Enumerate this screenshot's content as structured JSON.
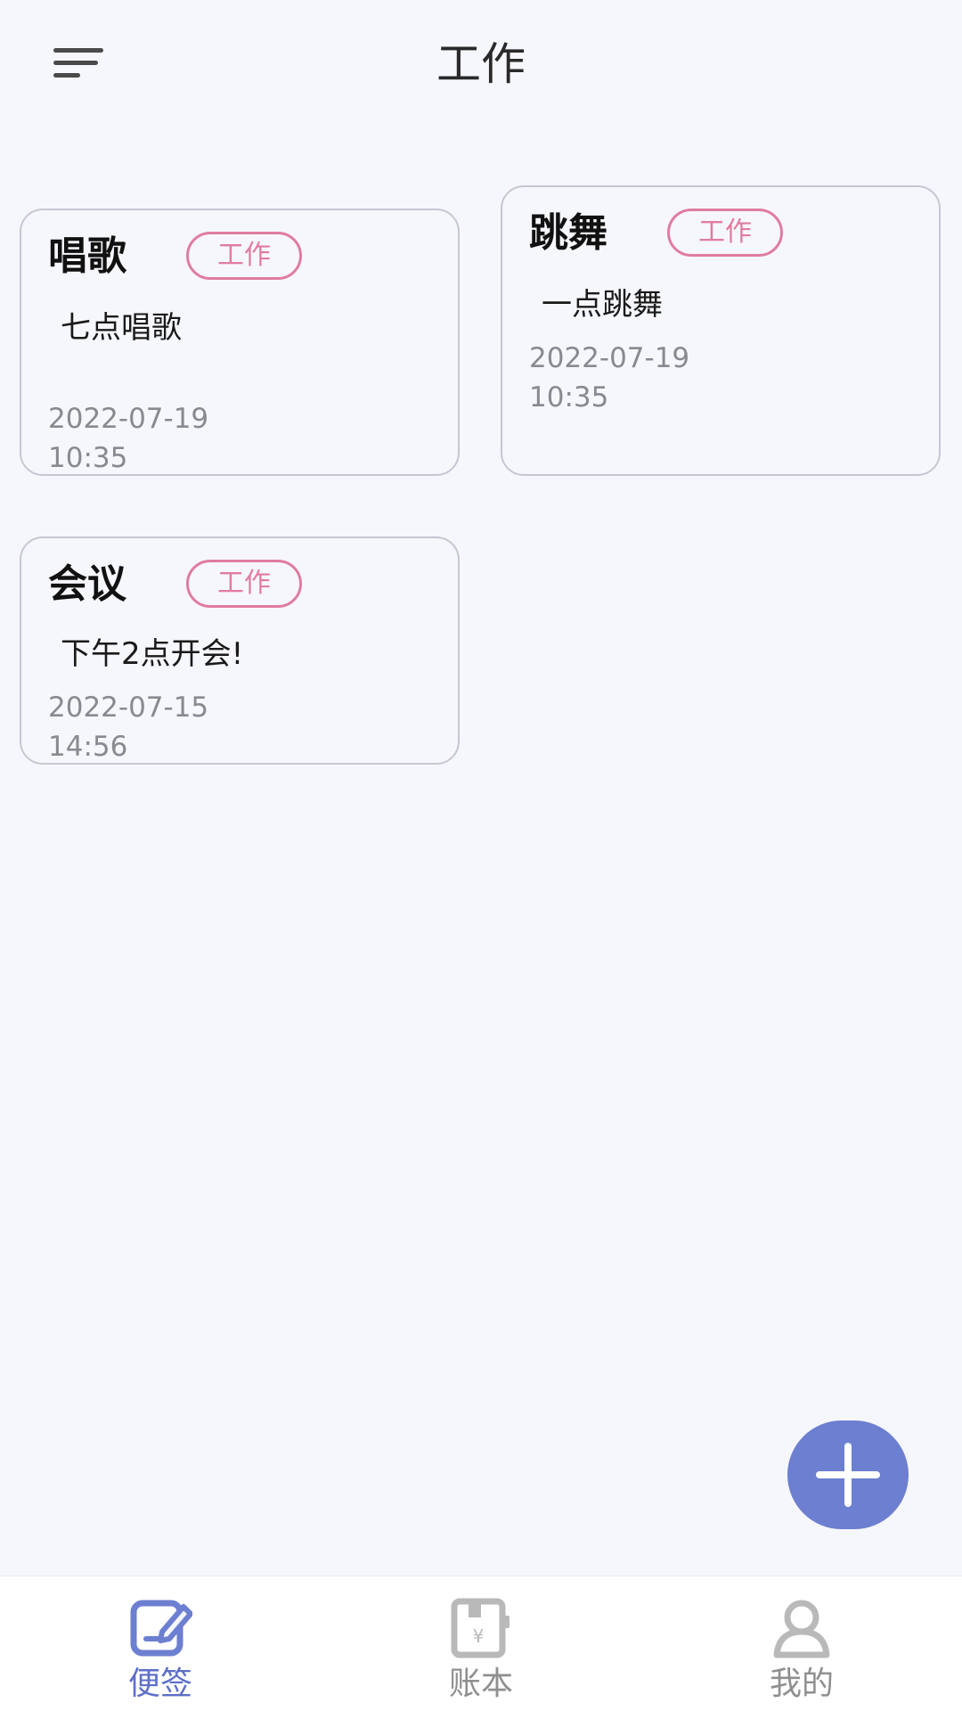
{
  "header": {
    "title": "工作",
    "menu_icon": "menu-icon"
  },
  "notes": [
    {
      "title": "唱歌",
      "tag": "工作",
      "content": "七点唱歌",
      "date": "2022-07-19",
      "time": "10:35"
    },
    {
      "title": "跳舞",
      "tag": "工作",
      "content": "一点跳舞",
      "date": "2022-07-19",
      "time": "10:35"
    },
    {
      "title": "会议",
      "tag": "工作",
      "content": "下午2点开会!",
      "date": "2022-07-15",
      "time": "14:56"
    }
  ],
  "fab": {
    "icon": "plus-icon"
  },
  "bottom_nav": {
    "items": [
      {
        "label": "便签",
        "icon": "note-edit-icon",
        "active": true
      },
      {
        "label": "账本",
        "icon": "ledger-icon",
        "active": false
      },
      {
        "label": "我的",
        "icon": "user-icon",
        "active": false
      }
    ]
  },
  "colors": {
    "background": "#f6f7fc",
    "accent": "#6c7fd0",
    "tag": "#e07c9f",
    "card_border": "#c6c7d3",
    "nav_active": "#5d6fc7",
    "nav_inactive": "#8f8f8f"
  }
}
